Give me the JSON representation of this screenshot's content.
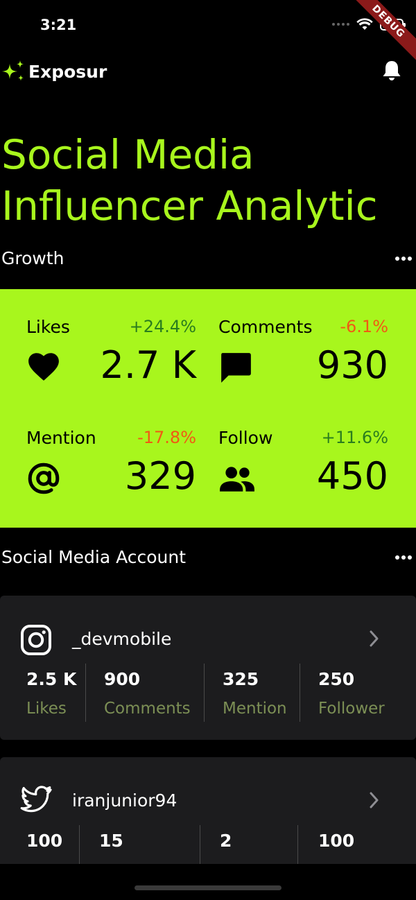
{
  "status_bar": {
    "time": "3:21"
  },
  "debug_ribbon": "DEBUG",
  "app": {
    "name": "Exposur"
  },
  "hero": {
    "line1": "Social Media",
    "line2": "Influencer Analytic"
  },
  "growth": {
    "title": "Growth",
    "stats": [
      {
        "label": "Likes",
        "change": "+24.4%",
        "trend": "up",
        "value": "2.7 K",
        "icon": "heart-icon"
      },
      {
        "label": "Comments",
        "change": "-6.1%",
        "trend": "down",
        "value": "930",
        "icon": "comment-icon"
      },
      {
        "label": "Mention",
        "change": "-17.8%",
        "trend": "down",
        "value": "329",
        "icon": "at-icon"
      },
      {
        "label": "Follow",
        "change": "+11.6%",
        "trend": "up",
        "value": "450",
        "icon": "people-icon"
      }
    ]
  },
  "accounts_section": {
    "title": "Social Media Account"
  },
  "accounts": [
    {
      "platform_icon": "instagram-icon",
      "username": "_devmobile",
      "metrics": [
        {
          "value": "2.5 K",
          "label": "Likes"
        },
        {
          "value": "900",
          "label": "Comments"
        },
        {
          "value": "325",
          "label": "Mention"
        },
        {
          "value": "250",
          "label": "Follower"
        }
      ]
    },
    {
      "platform_icon": "twitter-icon",
      "username": "iranjunior94",
      "metrics": [
        {
          "value": "100",
          "label": ""
        },
        {
          "value": "15",
          "label": ""
        },
        {
          "value": "2",
          "label": ""
        },
        {
          "value": "100",
          "label": ""
        }
      ]
    }
  ],
  "colors": {
    "accent": "#a8f61d",
    "up": "#2a7d1e",
    "down": "#f05a14",
    "card": "#1c1c1e",
    "muted_label": "#7c8f55"
  }
}
